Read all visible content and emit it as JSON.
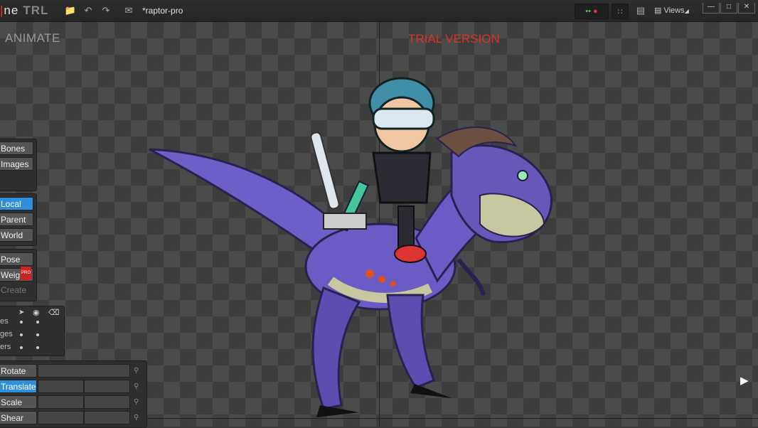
{
  "app": {
    "logo_prefix": "ne",
    "logo_suffix": "TRL",
    "document_title": "*raptor-pro",
    "views_label": "Views",
    "mode_label": "ANIMATE",
    "watermark": "TRIAL VERSION"
  },
  "toolbar_icons": [
    "folder-icon",
    "undo-icon",
    "redo-icon",
    "envelope-icon"
  ],
  "left_panel": {
    "show_buttons": [
      {
        "label": "Bones"
      },
      {
        "label": "Images"
      }
    ],
    "axes_buttons": [
      {
        "label": "Local",
        "active": true
      },
      {
        "label": "Parent"
      },
      {
        "label": "World"
      }
    ],
    "pose_buttons": [
      {
        "label": "Pose"
      },
      {
        "label": "Weights",
        "badge": "PRO"
      },
      {
        "label": "Create",
        "disabled": true
      }
    ],
    "visibility_rows": [
      {
        "label": "es"
      },
      {
        "label": "ges"
      },
      {
        "label": "ers"
      }
    ],
    "transform_tools": [
      {
        "label": "Rotate",
        "active": false
      },
      {
        "label": "Translate",
        "active": true
      },
      {
        "label": "Scale",
        "active": false
      },
      {
        "label": "Shear",
        "active": false
      }
    ]
  },
  "colors": {
    "accent": "#2f8fd8",
    "watermark": "#d9341f",
    "raptor": "#6a5acd"
  }
}
